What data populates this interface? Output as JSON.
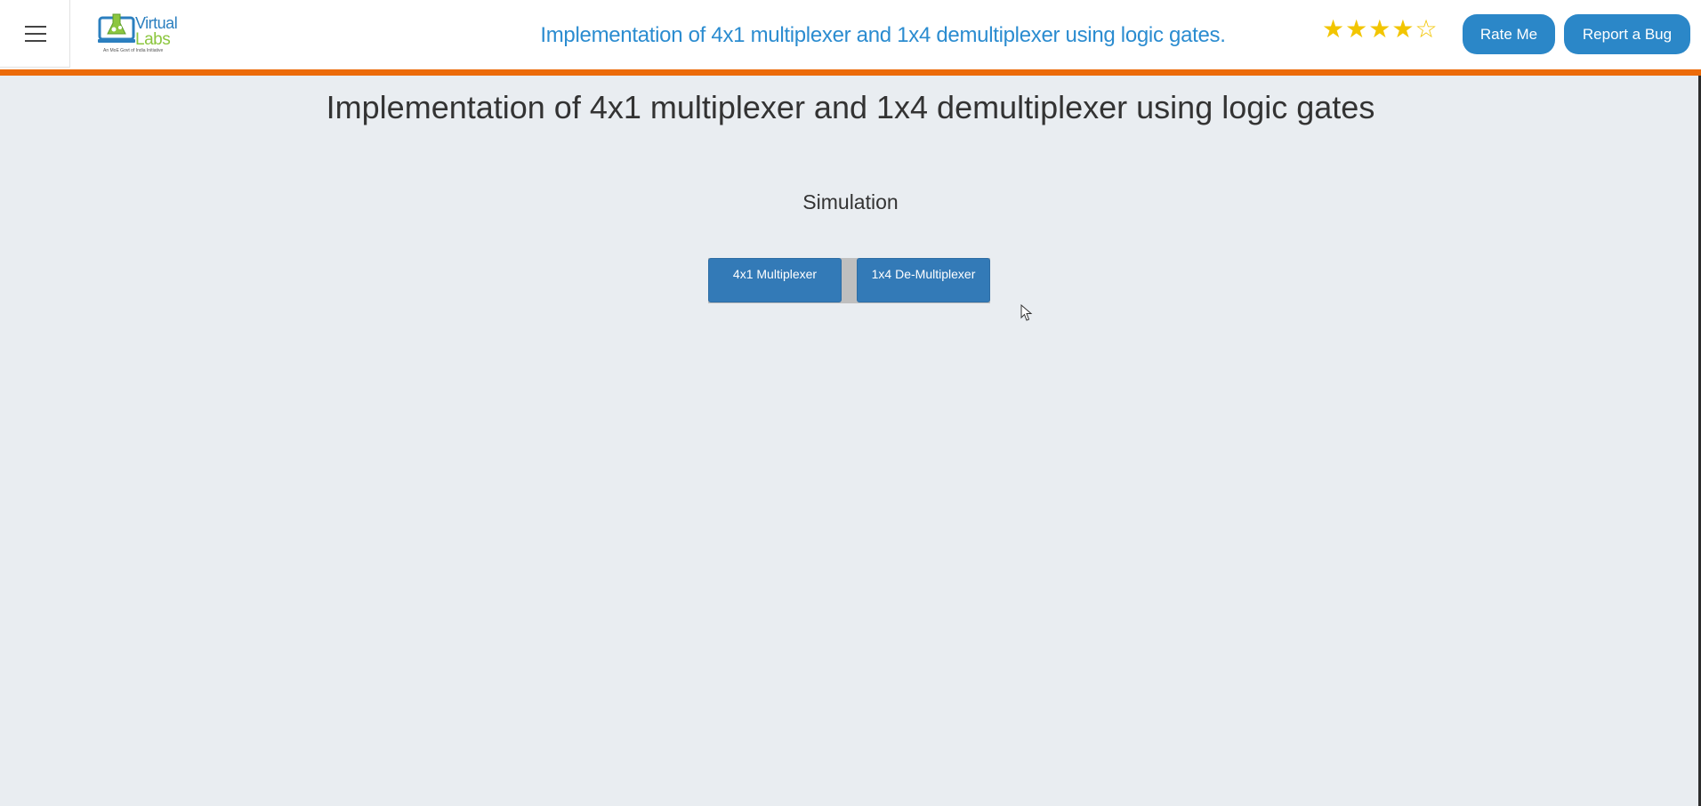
{
  "header": {
    "menu_icon": "hamburger-menu-icon",
    "logo": {
      "word1": "Virtual",
      "word2": "Labs",
      "tagline": "An MoE Govt of India Initiative"
    },
    "title": "Implementation of 4x1 multiplexer and 1x4 demultiplexer using logic gates.",
    "rating": {
      "value": 4,
      "max": 5,
      "star_color": "#f2c500"
    },
    "rate_button": "Rate Me",
    "bug_button": "Report a Bug"
  },
  "colors": {
    "accent_orange": "#ec6b0a",
    "button_blue": "#2b87c8",
    "title_blue": "#2b8cd0",
    "background": "#e9edf1"
  },
  "main": {
    "title": "Implementation of 4x1 multiplexer and 1x4 demultiplexer using logic gates",
    "section": "Simulation",
    "buttons": [
      {
        "label": "4x1 Multiplexer"
      },
      {
        "label": "1x4 De-Multiplexer"
      }
    ]
  }
}
